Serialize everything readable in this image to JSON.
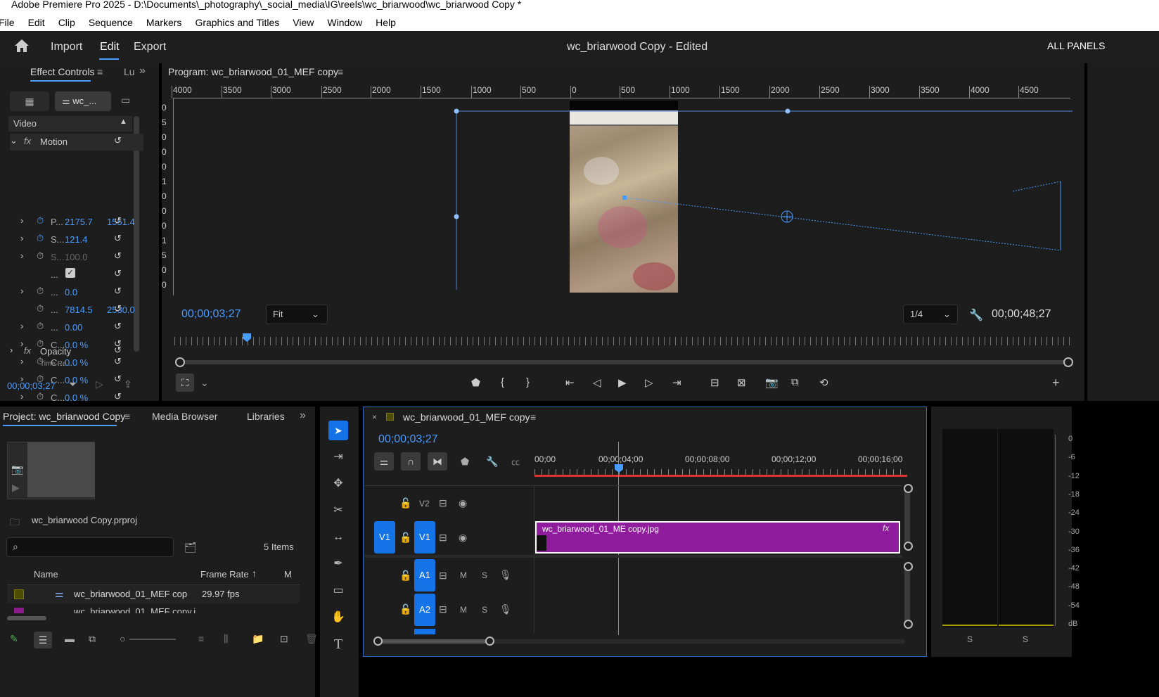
{
  "window": {
    "title": "Adobe Premiere Pro 2025 - D:\\Documents\\_photography\\_social_media\\IG\\reels\\wc_briarwood\\wc_briarwood Copy *"
  },
  "menu": [
    "File",
    "Edit",
    "Clip",
    "Sequence",
    "Markers",
    "Graphics and Titles",
    "View",
    "Window",
    "Help"
  ],
  "workspace": {
    "tabs": [
      "Import",
      "Edit",
      "Export"
    ],
    "active": "Edit",
    "project_title": "wc_briarwood Copy - Edited",
    "all_panels": "ALL PANELS"
  },
  "effect_controls": {
    "tab": "Effect Controls",
    "tab2": "Lu",
    "clip_btn": "wc_...",
    "video_label": "Video",
    "motion": "Motion",
    "opacity": "Opacity",
    "time_remap": "Time Re...",
    "rows": [
      {
        "name": "P...",
        "v1": "2175.7",
        "v2": "1551.4"
      },
      {
        "name": "S...",
        "v1": "121.4",
        "v2": ""
      },
      {
        "name": "S...",
        "v1": "100.0",
        "v2": ""
      },
      {
        "name": "...",
        "v1": "",
        "v2": ""
      },
      {
        "name": "...",
        "v1": "0.0",
        "v2": ""
      },
      {
        "name": "...",
        "v1": "7814.5",
        "v2": "2530.0"
      },
      {
        "name": "...",
        "v1": "0.00",
        "v2": ""
      },
      {
        "name": "C...",
        "v1": "0.0 %",
        "v2": ""
      },
      {
        "name": "C...",
        "v1": "0.0 %",
        "v2": ""
      },
      {
        "name": "C...",
        "v1": "0.0 %",
        "v2": ""
      },
      {
        "name": "C...",
        "v1": "0.0 %",
        "v2": ""
      }
    ],
    "timecode": "00;00;03;27"
  },
  "program": {
    "title": "Program: wc_briarwood_01_MEF copy",
    "ruler": [
      "4000",
      "3500",
      "3000",
      "2500",
      "2000",
      "1500",
      "1000",
      "500",
      "0",
      "500",
      "1000",
      "1500",
      "2000",
      "2500",
      "3000",
      "3500",
      "4000",
      "4500"
    ],
    "vruler": [
      "0",
      "5",
      "0",
      "0",
      "0",
      "1",
      "0",
      "0",
      "0",
      "1",
      "5",
      "0",
      "0"
    ],
    "timecode": "00;00;03;27",
    "fit": "Fit",
    "resolution": "1/4",
    "duration": "00;00;48;27"
  },
  "project": {
    "tabs": [
      "Project: wc_briarwood Copy",
      "Media Browser",
      "Libraries"
    ],
    "file": "wc_briarwood Copy.prproj",
    "items_count": "5 Items",
    "search_placeholder": "",
    "columns": [
      "Name",
      "Frame Rate",
      "M"
    ],
    "rows": [
      {
        "name": "wc_briarwood_01_MEF cop",
        "fps": "29.97 fps",
        "color": "#4d4d00"
      },
      {
        "name": "wc_briarwood_01_MEF copy.j",
        "fps": "",
        "color": "#8b1a8b"
      }
    ]
  },
  "timeline": {
    "tab": "wc_briarwood_01_MEF copy",
    "timecode": "00;00;03;27",
    "ruler": [
      "00;00",
      "00;00;04;00",
      "00;00;08;00",
      "00;00;12;00",
      "00;00;16;00"
    ],
    "tracks": {
      "v2": "V2",
      "v1": "V1",
      "a1": "A1",
      "a2": "A2",
      "m": "M",
      "s": "S"
    },
    "clip": {
      "name": "wc_briarwood_01_ME copy.jpg",
      "fx": "fx",
      "color": "#8e1c9c"
    }
  },
  "meters": {
    "scale": [
      "0",
      "-6",
      "-12",
      "-18",
      "-24",
      "-30",
      "-36",
      "-42",
      "-48",
      "-54",
      "dB"
    ],
    "solo": [
      "S",
      "S"
    ]
  }
}
